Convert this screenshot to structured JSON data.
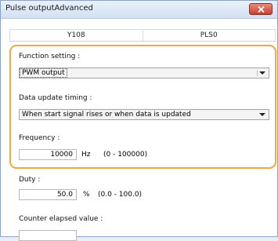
{
  "window": {
    "title": "Pulse outputAdvanced"
  },
  "tabs": [
    "Y108",
    "PLS0"
  ],
  "function_setting": {
    "label": "Function setting :",
    "value": "PWM output"
  },
  "data_update_timing": {
    "label": "Data update timing :",
    "value": "When start signal rises or when data is updated"
  },
  "frequency": {
    "label": "Frequency :",
    "value": "10000",
    "unit": "Hz",
    "range": "(0 - 100000)"
  },
  "duty": {
    "label": "Duty :",
    "value": "50.0",
    "unit": "%",
    "range": "(0.0 - 100.0)"
  },
  "counter_elapsed": {
    "label": "Counter elapsed value :"
  },
  "colors": {
    "highlight_border": "#f0a93a",
    "title_bar": "#d3e1f3",
    "close_button": "#c8412e"
  }
}
